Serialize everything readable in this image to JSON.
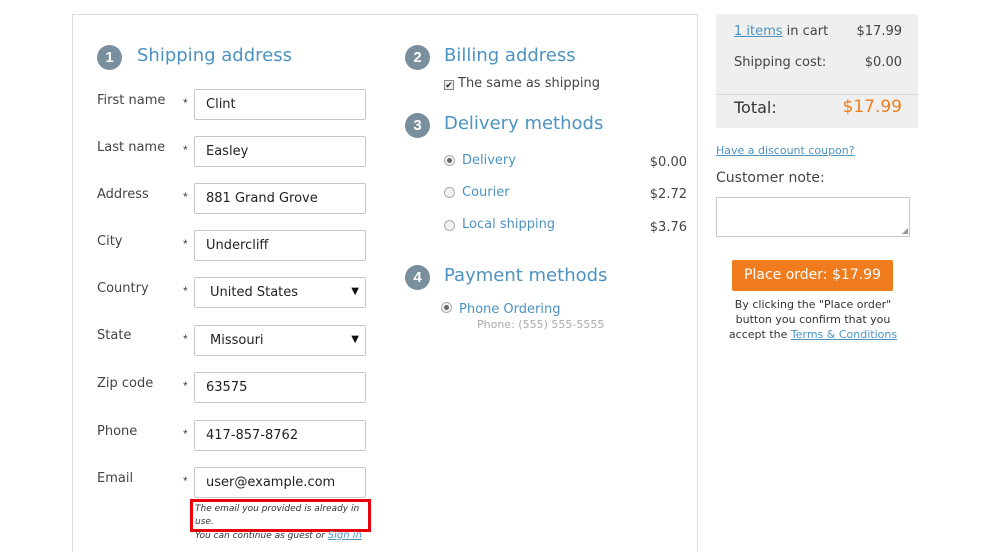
{
  "shipping": {
    "step": "1",
    "title": "Shipping address",
    "required_mark": "*",
    "fields": {
      "first_name": {
        "label": "First name",
        "value": "Clint"
      },
      "last_name": {
        "label": "Last name",
        "value": "Easley"
      },
      "address": {
        "label": "Address",
        "value": "881 Grand Grove"
      },
      "city": {
        "label": "City",
        "value": "Undercliff"
      },
      "country": {
        "label": "Country",
        "value": "United States"
      },
      "state": {
        "label": "State",
        "value": "Missouri"
      },
      "zip": {
        "label": "Zip code",
        "value": "63575"
      },
      "phone": {
        "label": "Phone",
        "value": "417-857-8762"
      },
      "email": {
        "label": "Email",
        "value": "user@example.com"
      }
    },
    "email_error": {
      "line1": "The email you provided is already in use.",
      "line2": "You can continue as guest or",
      "link": "Sign in"
    }
  },
  "billing": {
    "step": "2",
    "title": "Billing address",
    "same_as_shipping": {
      "label": "The same as shipping",
      "checked": true
    }
  },
  "delivery": {
    "step": "3",
    "title": "Delivery methods",
    "options": [
      {
        "label": "Delivery",
        "price": "$0.00",
        "selected": true
      },
      {
        "label": "Courier",
        "price": "$2.72",
        "selected": false
      },
      {
        "label": "Local shipping",
        "price": "$3.76",
        "selected": false
      }
    ]
  },
  "payment": {
    "step": "4",
    "title": "Payment methods",
    "options": [
      {
        "label": "Phone Ordering",
        "sub": "Phone: (555) 555-5555",
        "selected": true
      }
    ]
  },
  "cart": {
    "items_link": "1 items",
    "items_suffix": " in cart",
    "items_price": "$17.99",
    "shipping_label": "Shipping cost:",
    "shipping_value": "$0.00",
    "total_label": "Total:",
    "total_value": "$17.99"
  },
  "sidebar": {
    "coupon_link": "Have a discount coupon?",
    "note_label": "Customer note:",
    "note_value": "",
    "place_order_label": "Place order: $17.99",
    "terms_prefix": "By clicking the \"Place order\" button you confirm that you accept the ",
    "terms_link": "Terms & Conditions"
  },
  "colors": {
    "accent": "#4c93c2",
    "order_button": "#f07c1d",
    "error_border": "#e8000b",
    "step_circle": "#7a8f9e"
  }
}
